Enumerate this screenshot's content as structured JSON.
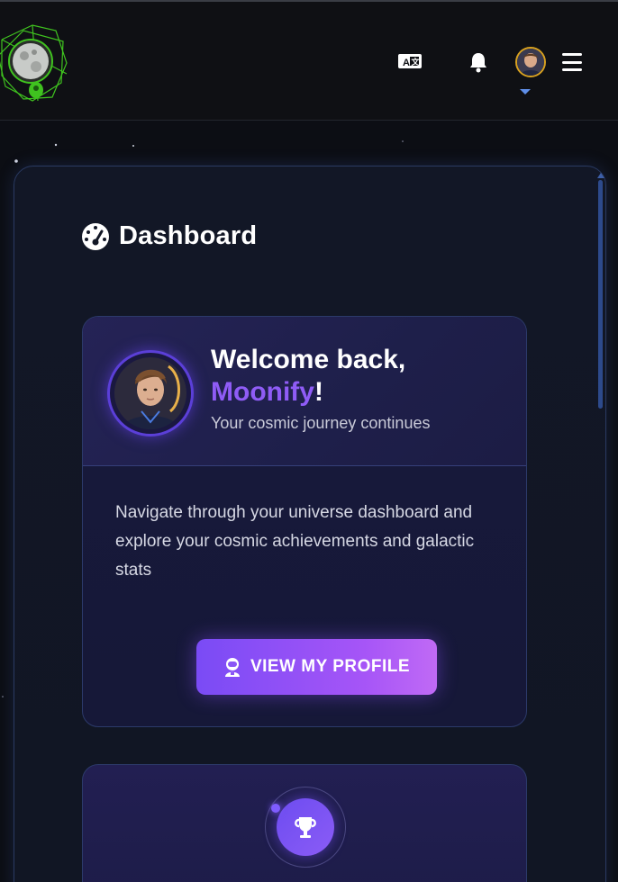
{
  "header": {
    "icons": [
      "logo-icon",
      "translate-icon",
      "bell-icon",
      "avatar",
      "chevron-down-icon",
      "menu-icon"
    ]
  },
  "dashboard": {
    "title": "Dashboard",
    "icon": "dashboard-gauge-icon"
  },
  "welcome": {
    "greeting": "Welcome back,",
    "username": "Moonify",
    "exclamation": "!",
    "subtitle": "Your cosmic journey continues",
    "description": "Navigate through your universe dashboard and explore your cosmic achievements and galactic stats",
    "button_label": "VIEW MY PROFILE",
    "button_icon": "astronaut-icon"
  },
  "achievements": {
    "icon": "trophy-icon"
  },
  "colors": {
    "accent": "#8f5cf6",
    "button_start": "#7a4bf5",
    "button_end": "#c06af5",
    "avatar_border": "#d8a11f",
    "background": "#0c0e14"
  }
}
